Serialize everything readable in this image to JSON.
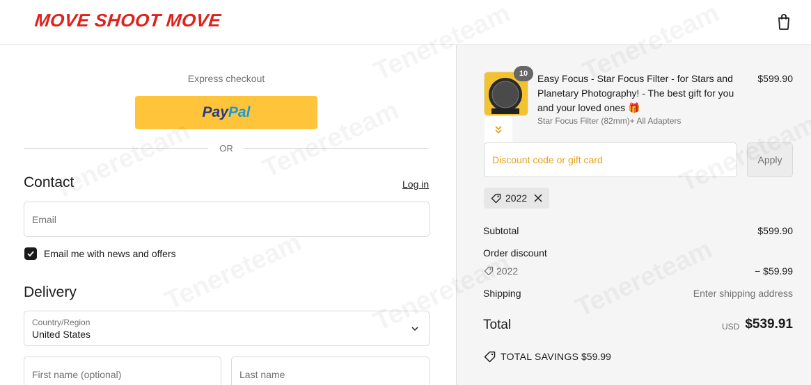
{
  "header": {
    "logo_text": "MOVE SHOOT MOVE",
    "cart_icon": "shopping-bag-icon"
  },
  "express": {
    "label": "Express checkout",
    "paypal_part1": "Pay",
    "paypal_part2": "Pal",
    "divider_text": "OR"
  },
  "contact": {
    "title": "Contact",
    "login_link": "Log in",
    "email_placeholder": "Email",
    "newsletter_label": "Email me with news and offers",
    "newsletter_checked": true
  },
  "delivery": {
    "title": "Delivery",
    "country_label": "Country/Region",
    "country_value": "United States",
    "first_name_placeholder": "First name (optional)",
    "last_name_placeholder": "Last name"
  },
  "summary": {
    "product": {
      "quantity": "10",
      "title": "Easy Focus - Star Focus Filter - for Stars and Planetary Photography! - The best gift for you and your loved ones 🎁",
      "variant": "Star Focus Filter (82mm)+ All Adapters",
      "price": "$599.90"
    },
    "discount_placeholder": "Discount code or gift card",
    "apply_label": "Apply",
    "applied_code": "2022",
    "subtotal_label": "Subtotal",
    "subtotal_value": "$599.90",
    "order_discount_label": "Order discount",
    "discount_code": "2022",
    "discount_value": "− $59.99",
    "shipping_label": "Shipping",
    "shipping_value": "Enter shipping address",
    "total_label": "Total",
    "total_currency": "USD",
    "total_value": "$539.91",
    "savings_label": "TOTAL SAVINGS",
    "savings_value": "$59.99"
  },
  "watermark": "Tenereteam",
  "colors": {
    "brand_red": "#e0201b",
    "paypal_yellow": "#ffc439",
    "discount_orange": "#e6a020"
  }
}
